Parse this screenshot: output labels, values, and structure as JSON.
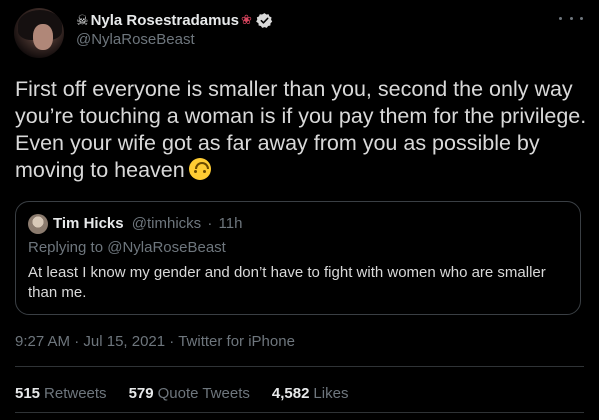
{
  "author": {
    "display_name": "Nyla Rosestradamus",
    "prefix_icon": "skull-icon",
    "suffix_icon": "rose-icon",
    "handle": "@NylaRoseBeast",
    "verified": true
  },
  "tweet": {
    "text": "First off everyone is smaller than you, second the only way you’re touching a woman is if you pay them for the privilege. Even your wife got as far away from you as possible by moving to heaven",
    "emoji": "upside-down-face-icon"
  },
  "quoted_tweet": {
    "name": "Tim Hicks",
    "handle": "@timhicks",
    "separator": "·",
    "age": "11h",
    "replying_prefix": "Replying to",
    "replying_to": "@NylaRoseBeast",
    "text": "At least I know my gender and don’t have to fight with women who are smaller than me."
  },
  "meta": {
    "time": "9:27 AM",
    "date": "Jul 15, 2021",
    "separator": "·",
    "source": "Twitter for iPhone"
  },
  "stats": [
    {
      "count": "515",
      "label": "Retweets"
    },
    {
      "count": "579",
      "label": "Quote Tweets"
    },
    {
      "count": "4,582",
      "label": "Likes"
    }
  ],
  "colors": {
    "background": "#000000",
    "text": "#d9d9d9",
    "muted": "#6e767d",
    "verified": "#d9d9d9",
    "emoji": "#ffcc33"
  }
}
